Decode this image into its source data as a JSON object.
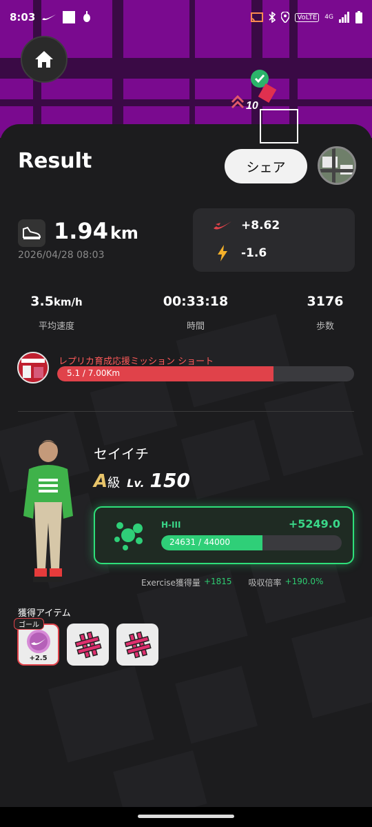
{
  "status_bar": {
    "time": "8:03",
    "network": "VoLTE",
    "network_gen": "4G",
    "icons": [
      "nike-swoosh-icon",
      "square-notification-icon",
      "android-debug-icon",
      "cast-icon",
      "bluetooth-icon",
      "location-icon",
      "signal-icon",
      "battery-icon"
    ]
  },
  "map": {
    "marker_level": "10",
    "icons": [
      "home-icon",
      "checkmark-icon"
    ]
  },
  "header": {
    "title": "Result",
    "share_label": "シェア"
  },
  "summary": {
    "distance_value": "1.94",
    "distance_unit": "km",
    "datetime": "2026/04/28 08:03",
    "nike_points": "+8.62",
    "energy": "-1.6"
  },
  "metrics": [
    {
      "value": "3.5",
      "unit": "km/h",
      "label": "平均速度"
    },
    {
      "value": "00:33:18",
      "unit": "",
      "label": "時間"
    },
    {
      "value": "3176",
      "unit": "",
      "label": "歩数"
    }
  ],
  "mission": {
    "title": "レプリカ育成応援ミッション ショート",
    "progress_text": "5.1 / 7.00Km",
    "progress_fraction": 0.7286
  },
  "character": {
    "name": "セイイチ",
    "grade": "A",
    "grade_suffix": "級",
    "level_label": "Lv.",
    "level": "150"
  },
  "experience": {
    "tier": "H-III",
    "gain": "+5249.0",
    "progress_text": "24631 / 44000",
    "progress_fraction": 0.5598
  },
  "exercise": {
    "label": "Exercise獲得量",
    "amount": "+1815",
    "rate_label": "吸収倍率",
    "rate": "+190.0%"
  },
  "items": {
    "label": "獲得アイテム",
    "goal_tag": "ゴール",
    "list": [
      {
        "name": "nike-token-item",
        "qty": "+2.5"
      },
      {
        "name": "hashtag-item-1",
        "qty": ""
      },
      {
        "name": "hashtag-item-2",
        "qty": ""
      }
    ]
  },
  "colors": {
    "map_purple": "#7a0a8f",
    "mission_red": "#e0424a",
    "exp_green": "#2fcf78",
    "grade_gold": "#e8c46a"
  }
}
